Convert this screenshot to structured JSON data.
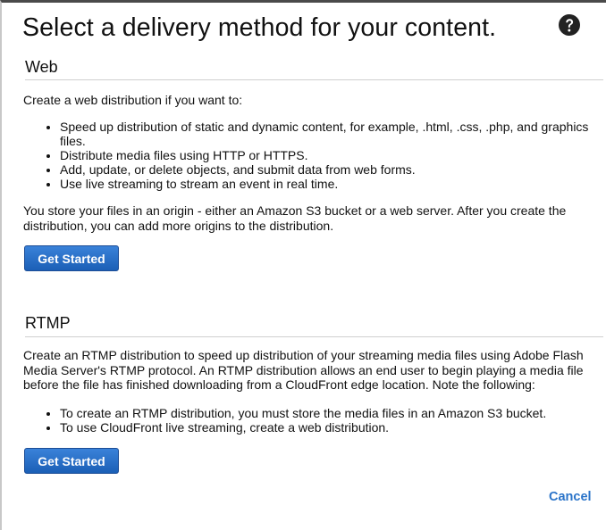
{
  "dialog": {
    "title": "Select a delivery method for your content.",
    "help_icon": "question-circle-icon"
  },
  "web": {
    "heading": "Web",
    "intro": "Create a web distribution if you want to:",
    "bullets": [
      "Speed up distribution of static and dynamic content, for example, .html, .css, .php, and graphics files.",
      "Distribute media files using HTTP or HTTPS.",
      "Add, update, or delete objects, and submit data from web forms.",
      "Use live streaming to stream an event in real time."
    ],
    "origins_text": "You store your files in an origin - either an Amazon S3 bucket or a web server. After you create the distribution, you can add more origins to the distribution.",
    "button_label": "Get Started"
  },
  "rtmp": {
    "heading": "RTMP",
    "intro": "Create an RTMP distribution to speed up distribution of your streaming media files using Adobe Flash Media Server's RTMP protocol. An RTMP distribution allows an end user to begin playing a media file before the file has finished downloading from a CloudFront edge location. Note the following:",
    "bullets": [
      "To create an RTMP distribution, you must store the media files in an Amazon S3 bucket.",
      "To use CloudFront live streaming, create a web distribution."
    ],
    "button_label": "Get Started"
  },
  "footer": {
    "cancel_label": "Cancel"
  },
  "colors": {
    "button_blue": "#1b5fb6",
    "link_blue": "#2b74c9",
    "help_icon": "#222222"
  }
}
